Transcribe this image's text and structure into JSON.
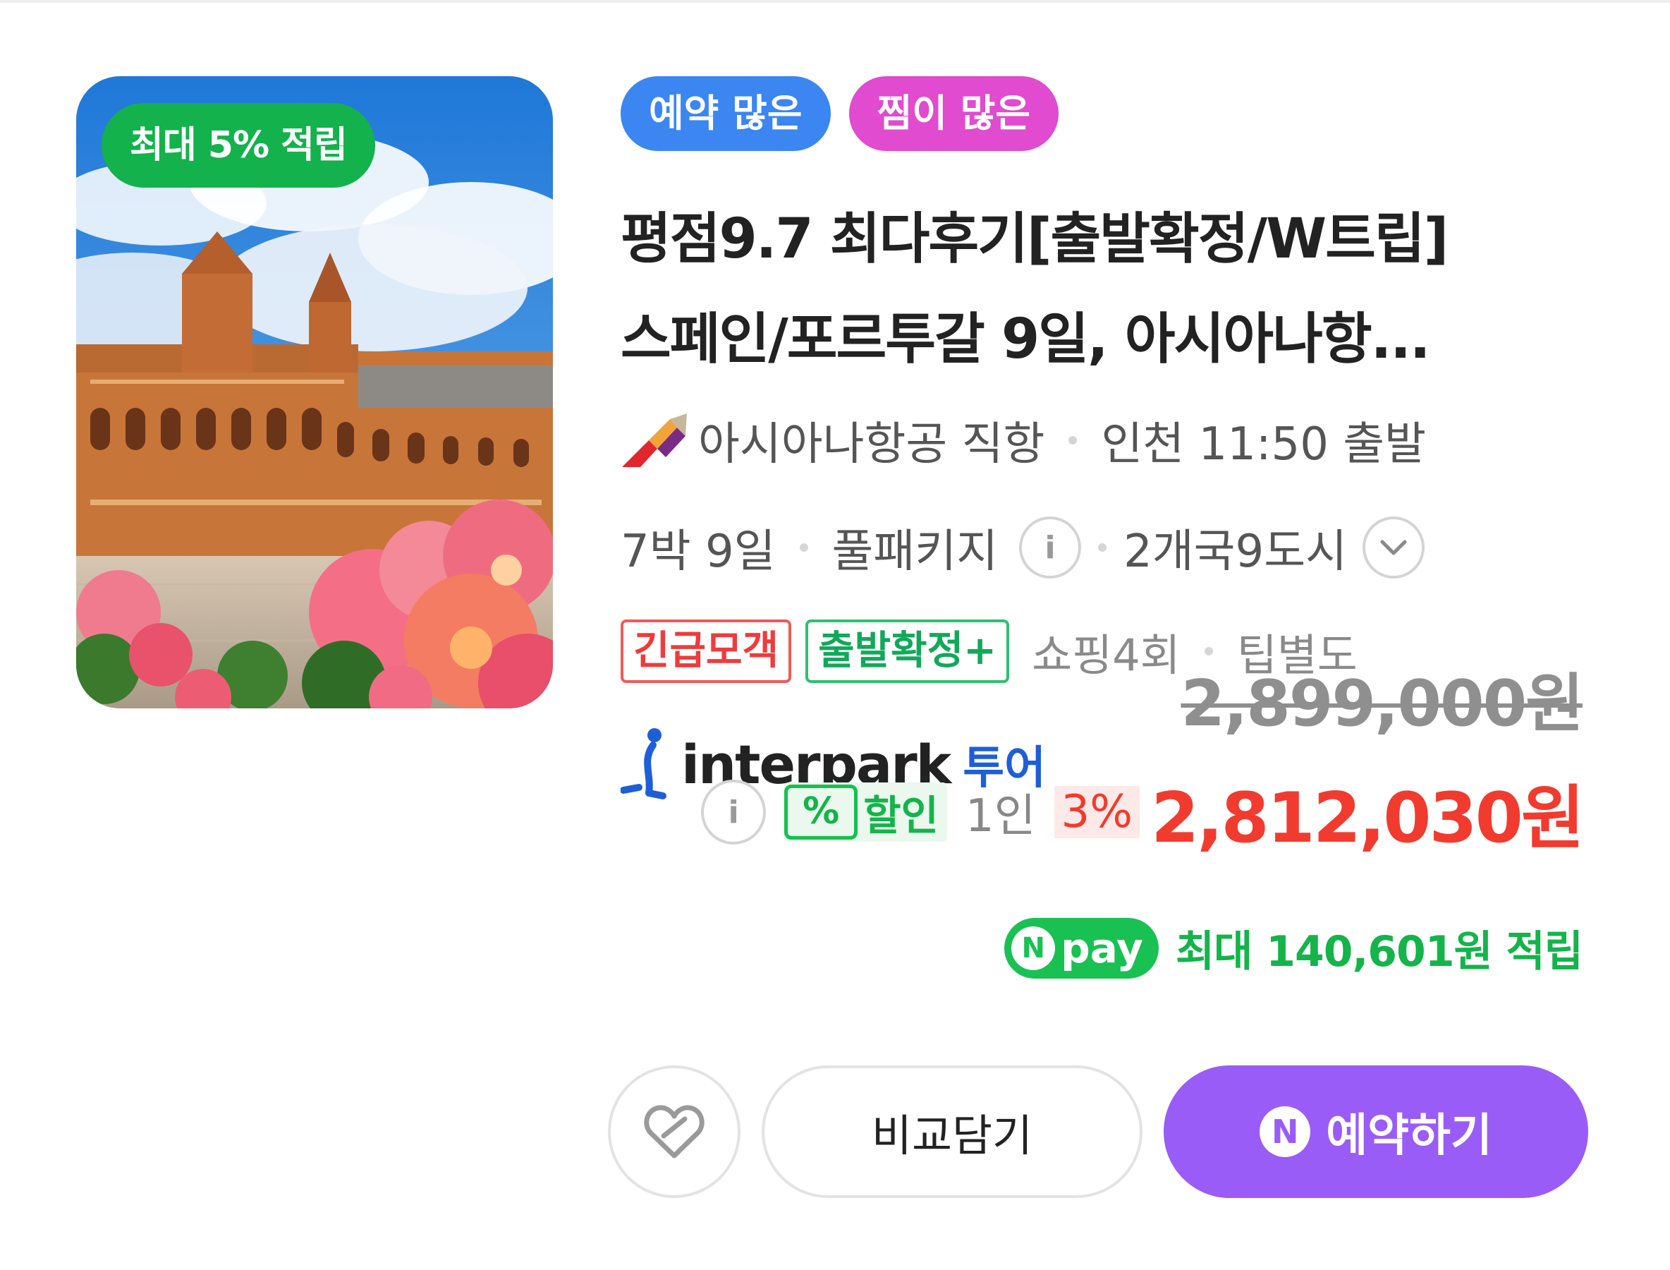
{
  "thumbnail": {
    "badge": "최대 5% 적립",
    "icon": "seville-plaza-photo"
  },
  "tags": [
    {
      "label": "예약 많은",
      "color": "#3b86f1"
    },
    {
      "label": "찜이 많은",
      "color": "#e04bcf"
    }
  ],
  "title": {
    "line1": "평점9.7 최다후기[출발확정/W트립]",
    "line2": "스페인/포르투갈 9일, 아시아나항..."
  },
  "flight": {
    "airline": "아시아나항공 직항",
    "departure": "인천 11:50 출발",
    "airline_icon": "asiana-logo-icon"
  },
  "trip": {
    "duration": "7박 9일",
    "type": "풀패키지",
    "info_icon": "i",
    "cities": "2개국9도시",
    "expand_icon": "chevron-down-icon"
  },
  "labels": {
    "urgent": "긴급모객",
    "confirmed": "출발확정+",
    "shopping": "쇼핑4회",
    "tip": "팁별도"
  },
  "seller": {
    "name": "interpark",
    "suffix": "투어"
  },
  "price": {
    "original": "2,899,000원",
    "info_icon": "i",
    "discount_icon": "%",
    "discount_label": "할인",
    "per_person": "1인",
    "percent": "3%",
    "final": "2,812,030원"
  },
  "npay": {
    "n": "N",
    "pay": "pay",
    "reward": "최대 140,601원 적립"
  },
  "actions": {
    "compare": "비교담기",
    "book_n": "N",
    "book": "예약하기"
  },
  "colors": {
    "accent_purple": "#9a5cf6",
    "sale_red": "#f23b2f",
    "green": "#14b44a"
  }
}
